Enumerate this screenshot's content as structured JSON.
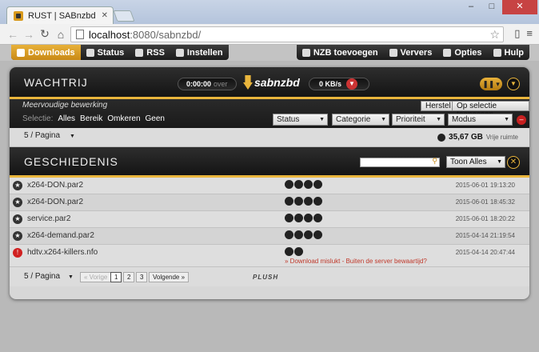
{
  "browser": {
    "tab_title": "RUST | SABnzbd",
    "url_host": "localhost",
    "url_path": ":8080/sabnzbd/"
  },
  "nav": {
    "left": [
      "Downloads",
      "Status",
      "RSS",
      "Instellen"
    ],
    "right": [
      "NZB toevoegen",
      "Ververs",
      "Opties",
      "Hulp"
    ]
  },
  "queue": {
    "title": "WACHTRIJ",
    "timeleft": "0:00:00",
    "timeleft_suffix": "over",
    "logo": "sabnzbd",
    "speed": "0 KB/s",
    "multi_label": "Meervoudige bewerking",
    "select_label": "Selectie:",
    "select_links": [
      "Alles",
      "Bereik",
      "Omkeren",
      "Geen"
    ],
    "btn_reset": "Herstel",
    "btn_apply": "Op selectie toepassen",
    "dropdowns": [
      "Status",
      "Categorie",
      "Prioriteit",
      "Modus"
    ],
    "per_page": "5 / Pagina",
    "free_space": "35,67 GB",
    "free_space_label": "Vrije ruimte"
  },
  "history": {
    "title": "GESCHIEDENIS",
    "show_all": "Toon Alles",
    "rows": [
      {
        "name": "x264-DON.par2",
        "date": "2015-06-01 19:13:20"
      },
      {
        "name": "x264-DON.par2",
        "date": "2015-06-01 18:45:32"
      },
      {
        "name": "service.par2",
        "date": "2015-06-01 18:20:22"
      },
      {
        "name": "x264-demand.par2",
        "date": "2015-04-14 21:19:54"
      },
      {
        "name": "hdtv.x264-killers.nfo",
        "date": "2015-04-14 20:47:44",
        "error": "» Download mislukt - Buiten de server bewaartijd?"
      }
    ],
    "per_page": "5 / Pagina",
    "prev": "« Vorige",
    "pages": [
      "1",
      "2",
      "3"
    ],
    "next": "Volgende »",
    "brand": "PLUSH"
  },
  "colors": {
    "accent": "#e9b53c",
    "error": "#c0392b"
  }
}
